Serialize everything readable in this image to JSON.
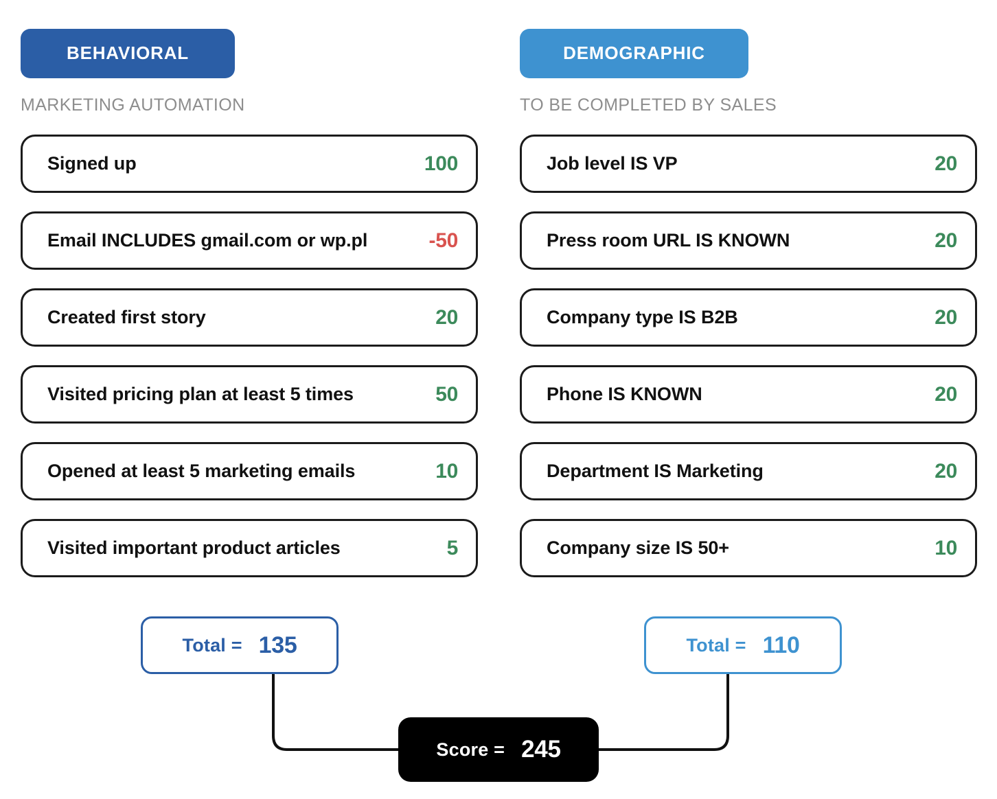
{
  "columns": [
    {
      "id": "behavioral",
      "badge_label": "BEHAVIORAL",
      "badge_color": "#2B5EA6",
      "subtitle": "MARKETING AUTOMATION",
      "rules": [
        {
          "label": "Signed up",
          "points": "100",
          "sign": "positive"
        },
        {
          "label": "Email INCLUDES gmail.com or wp.pl",
          "points": "-50",
          "sign": "negative"
        },
        {
          "label": "Created first story",
          "points": "20",
          "sign": "positive"
        },
        {
          "label": "Visited pricing plan at least 5 times",
          "points": "50",
          "sign": "positive"
        },
        {
          "label": "Opened at least 5 marketing emails",
          "points": "10",
          "sign": "positive"
        },
        {
          "label": "Visited important product articles",
          "points": "5",
          "sign": "positive"
        }
      ],
      "total": {
        "label": "Total =",
        "value": "135",
        "color": "#2B5EA6"
      }
    },
    {
      "id": "demographic",
      "badge_label": "DEMOGRAPHIC",
      "badge_color": "#3E92D0",
      "subtitle": "TO BE COMPLETED BY SALES",
      "rules": [
        {
          "label": "Job level IS VP",
          "points": "20",
          "sign": "positive"
        },
        {
          "label": "Press room URL IS KNOWN",
          "points": "20",
          "sign": "positive"
        },
        {
          "label": "Company type IS B2B",
          "points": "20",
          "sign": "positive"
        },
        {
          "label": "Phone IS KNOWN",
          "points": "20",
          "sign": "positive"
        },
        {
          "label": "Department IS Marketing",
          "points": "20",
          "sign": "positive"
        },
        {
          "label": "Company size IS 50+",
          "points": "10",
          "sign": "positive"
        }
      ],
      "total": {
        "label": "Total =",
        "value": "110",
        "color": "#3E92D0"
      }
    }
  ],
  "score": {
    "label": "Score =",
    "value": "245",
    "background": "#000000",
    "text_color": "#FFFFFF"
  },
  "colors": {
    "positive_points": "#3C8A5B",
    "negative_points": "#D9534F",
    "subtitle_gray": "#8D8D8D",
    "rule_border": "#1B1B1B",
    "connector": "#111111",
    "page_background": "#FFFFFF"
  }
}
